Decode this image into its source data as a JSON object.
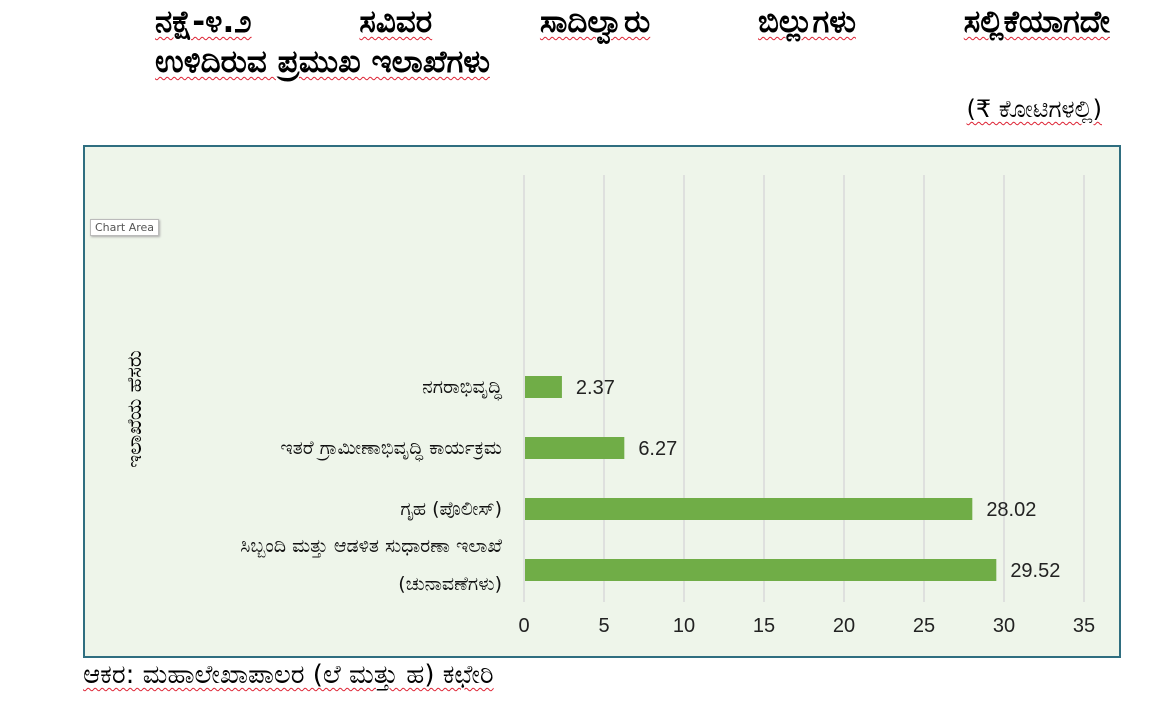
{
  "title": {
    "line1_words": [
      "ನಕ್ಷೆ-೪.೨",
      "ಸವಿವರ",
      "ಸಾದಿಲ್ವಾರು",
      "ಬಿಲ್ಲುಗಳು",
      "ಸಲ್ಲಿಕೆಯಾಗದೇ"
    ],
    "line2": "ಉಳಿದಿರುವ ಪ್ರಮುಖ ಇಲಾಖೆಗಳು"
  },
  "unit_note": "(₹ ಕೋಟಿಗಳಲ್ಲಿ)",
  "tooltip": "Chart Area",
  "source": "ಆಕರ: ಮಹಾಲೇಖಾಪಾಲರ (ಲೆ ಮತ್ತು ಹ) ಕಛೇರಿ",
  "colors": {
    "bar": "#70ad47",
    "plot_bg": "#eef5ea",
    "border": "#2f6e80",
    "grid": "#d9d9d9"
  },
  "chart_data": {
    "type": "bar",
    "orientation": "horizontal",
    "ylabel": "ಇಲಾಖೆಯ ಹೆಸರು",
    "xlabel": "",
    "xlim": [
      0,
      35
    ],
    "xticks": [
      0,
      5,
      10,
      15,
      20,
      25,
      30,
      35
    ],
    "grid": true,
    "legend": "none",
    "categories": [
      [
        "ನಗರಾಭಿವೃದ್ಧಿ"
      ],
      [
        "ಇತರೆ ಗ್ರಾಮೀಣಾಭಿವೃದ್ಧಿ ಕಾರ್ಯಕ್ರಮ"
      ],
      [
        "ಗೃಹ (ಪೊಲೀಸ್)"
      ],
      [
        "ಸಿಬ್ಬಂದಿ ಮತ್ತು ಆಡಳಿತ ಸುಧಾರಣಾ ಇಲಾಖೆ",
        "(ಚುನಾವಣೆಗಳು)"
      ]
    ],
    "values": [
      2.37,
      6.27,
      28.02,
      29.52
    ],
    "data_labels": [
      "2.37",
      "6.27",
      "28.02",
      "29.52"
    ]
  }
}
